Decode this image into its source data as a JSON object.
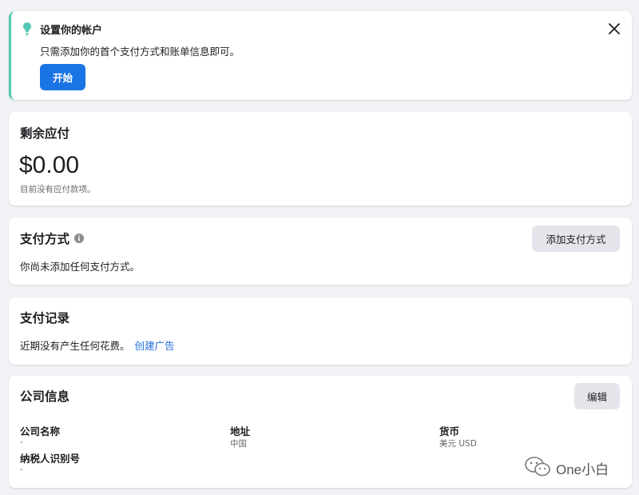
{
  "setup": {
    "title": "设置你的帐户",
    "description": "只需添加你的首个支付方式和账单信息即可。",
    "start_label": "开始"
  },
  "balance": {
    "title": "剩余应付",
    "amount": "$0.00",
    "note": "目前没有应付款项。"
  },
  "payment_method": {
    "title": "支付方式",
    "add_label": "添加支付方式",
    "empty_text": "你尚未添加任何支付方式。"
  },
  "history": {
    "title": "支付记录",
    "empty_text": "近期没有产生任何花费。",
    "link_label": "创建广告"
  },
  "business": {
    "title": "公司信息",
    "edit_label": "编辑",
    "fields": [
      {
        "label": "公司名称",
        "value": "-"
      },
      {
        "label": "地址",
        "value": "中国"
      },
      {
        "label": "货币",
        "value": "美元 USD"
      },
      {
        "label": "纳税人识别号",
        "value": "-"
      }
    ]
  },
  "watermark": {
    "text": "One小白"
  },
  "colors": {
    "accent": "#1b74e4",
    "banner_border": "#54c7b3",
    "link": "#216fdb",
    "background": "#f0f2f5"
  }
}
